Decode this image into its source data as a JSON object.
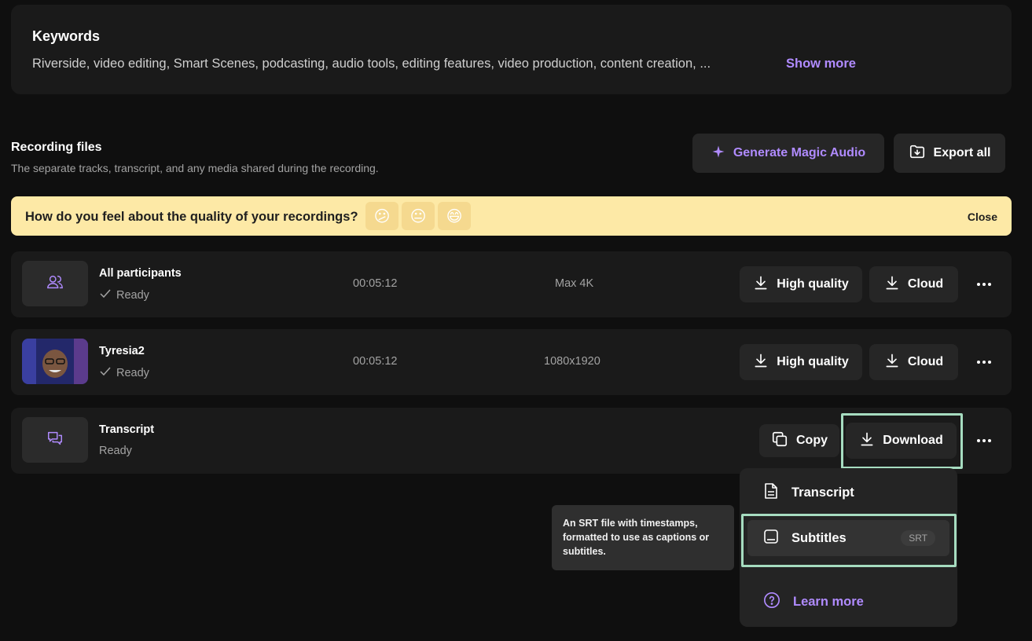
{
  "keywords": {
    "title": "Keywords",
    "text": "Riverside, video editing, Smart Scenes, podcasting, audio tools, editing features, video production, content creation, ...",
    "show_more": "Show more"
  },
  "recording_files": {
    "title": "Recording files",
    "subtitle": "The separate tracks, transcript, and any media shared during the recording.",
    "magic_audio_label": "Generate Magic Audio",
    "export_all_label": "Export all"
  },
  "feedback": {
    "question": "How do you feel about the quality of your recordings?",
    "emojis": [
      "😕",
      "😐",
      "😄"
    ],
    "close_label": "Close"
  },
  "rows": [
    {
      "name": "All participants",
      "status": "Ready",
      "duration": "00:05:12",
      "resolution": "Max 4K",
      "hq_label": "High quality",
      "cloud_label": "Cloud"
    },
    {
      "name": "Tyresia2",
      "status": "Ready",
      "duration": "00:05:12",
      "resolution": "1080x1920",
      "hq_label": "High quality",
      "cloud_label": "Cloud"
    }
  ],
  "transcript_row": {
    "name": "Transcript",
    "status": "Ready",
    "copy_label": "Copy",
    "download_label": "Download"
  },
  "dropdown": {
    "items": [
      {
        "label": "Transcript"
      },
      {
        "label": "Subtitles",
        "badge": "SRT"
      }
    ],
    "learn_more": "Learn more"
  },
  "tooltip": {
    "text": "An SRT file with timestamps, formatted to use as captions or subtitles."
  },
  "colors": {
    "background": "#0f0f0f",
    "card": "#1a1a1a",
    "accent": "#b08bff",
    "banner": "#fde9a6",
    "highlight": "#a6dcc0"
  }
}
